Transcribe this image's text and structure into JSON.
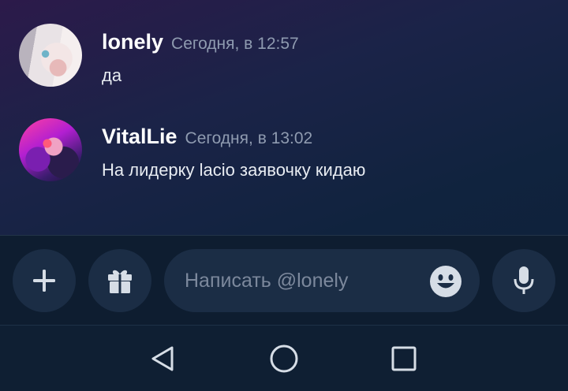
{
  "messages": [
    {
      "username": "lonely",
      "timestamp": "Сегодня, в 12:57",
      "text": "да"
    },
    {
      "username": "VitalLie",
      "timestamp": "Сегодня, в 13:02",
      "text": "На лидерку lacio заявочку кидаю"
    }
  ],
  "composer": {
    "placeholder": "Написать @lonely",
    "value": "",
    "icons": {
      "add": "plus-icon",
      "gift": "gift-icon",
      "emoji": "emoji-icon",
      "mic": "microphone-icon"
    }
  },
  "navigation": {
    "icons": [
      "back-triangle-icon",
      "home-circle-icon",
      "recents-square-icon"
    ]
  },
  "colors": {
    "background": "#10233e",
    "button_bg": "#1b2d45",
    "username": "#ffffff",
    "timestamp": "#8f9bb0",
    "message_text": "#e8ecf2",
    "placeholder": "#7c889c",
    "icon": "#d6dde6"
  }
}
